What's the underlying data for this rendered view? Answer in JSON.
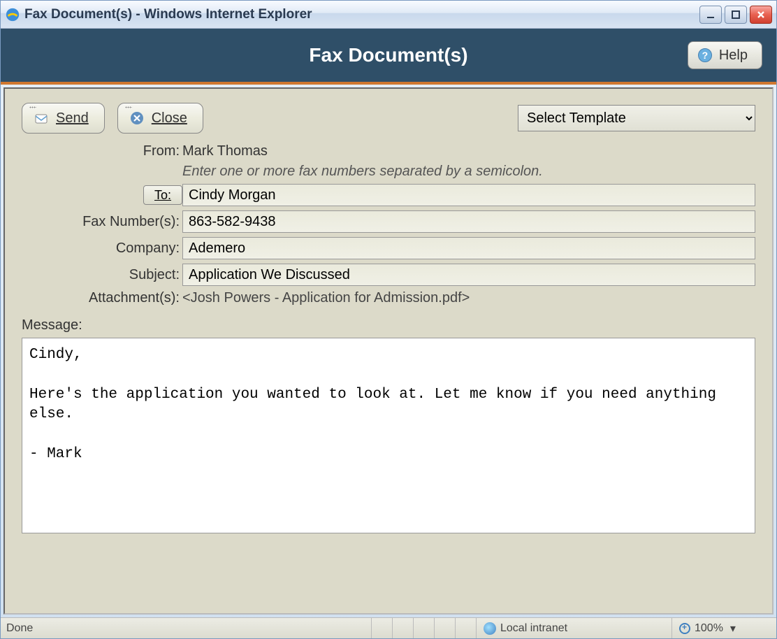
{
  "window": {
    "title": "Fax Document(s) - Windows Internet Explorer"
  },
  "header": {
    "title": "Fax Document(s)",
    "help_label": "Help"
  },
  "toolbar": {
    "send_label": "Send",
    "close_label": "Close",
    "template_select": "Select Template"
  },
  "form": {
    "from_label": "From:",
    "from_value": "Mark Thomas",
    "hint": "Enter one or more fax numbers separated by a semicolon.",
    "to_button": "To:",
    "to_value": "Cindy Morgan",
    "fax_label": "Fax Number(s):",
    "fax_value": "863-582-9438",
    "company_label": "Company:",
    "company_value": "Ademero",
    "subject_label": "Subject:",
    "subject_value": "Application We Discussed",
    "attachments_label": "Attachment(s):",
    "attachments_value": "<Josh Powers - Application for Admission.pdf>",
    "message_label": "Message:",
    "message_value": "Cindy,\n\nHere's the application you wanted to look at. Let me know if you need anything else.\n\n- Mark"
  },
  "statusbar": {
    "status": "Done",
    "zone": "Local intranet",
    "zoom": "100%"
  }
}
